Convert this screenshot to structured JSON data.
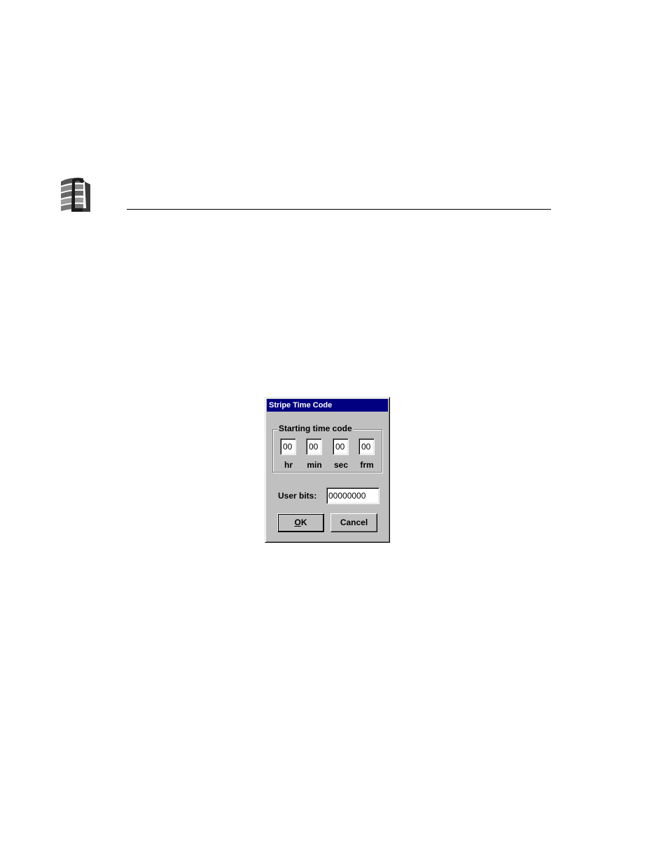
{
  "dialog": {
    "title": "Stripe Time Code",
    "group_label": "Starting time code",
    "time_fields": [
      {
        "value": "00",
        "caption": "hr"
      },
      {
        "value": "00",
        "caption": "min"
      },
      {
        "value": "00",
        "caption": "sec"
      },
      {
        "value": "00",
        "caption": "frm"
      }
    ],
    "user_bits_label": "User bits:",
    "user_bits_value": "00000000",
    "ok_mnemonic": "O",
    "ok_rest": "K",
    "cancel_label": "Cancel"
  },
  "colors": {
    "titlebar": "#000080",
    "dialog_face": "#c0c0c0"
  }
}
